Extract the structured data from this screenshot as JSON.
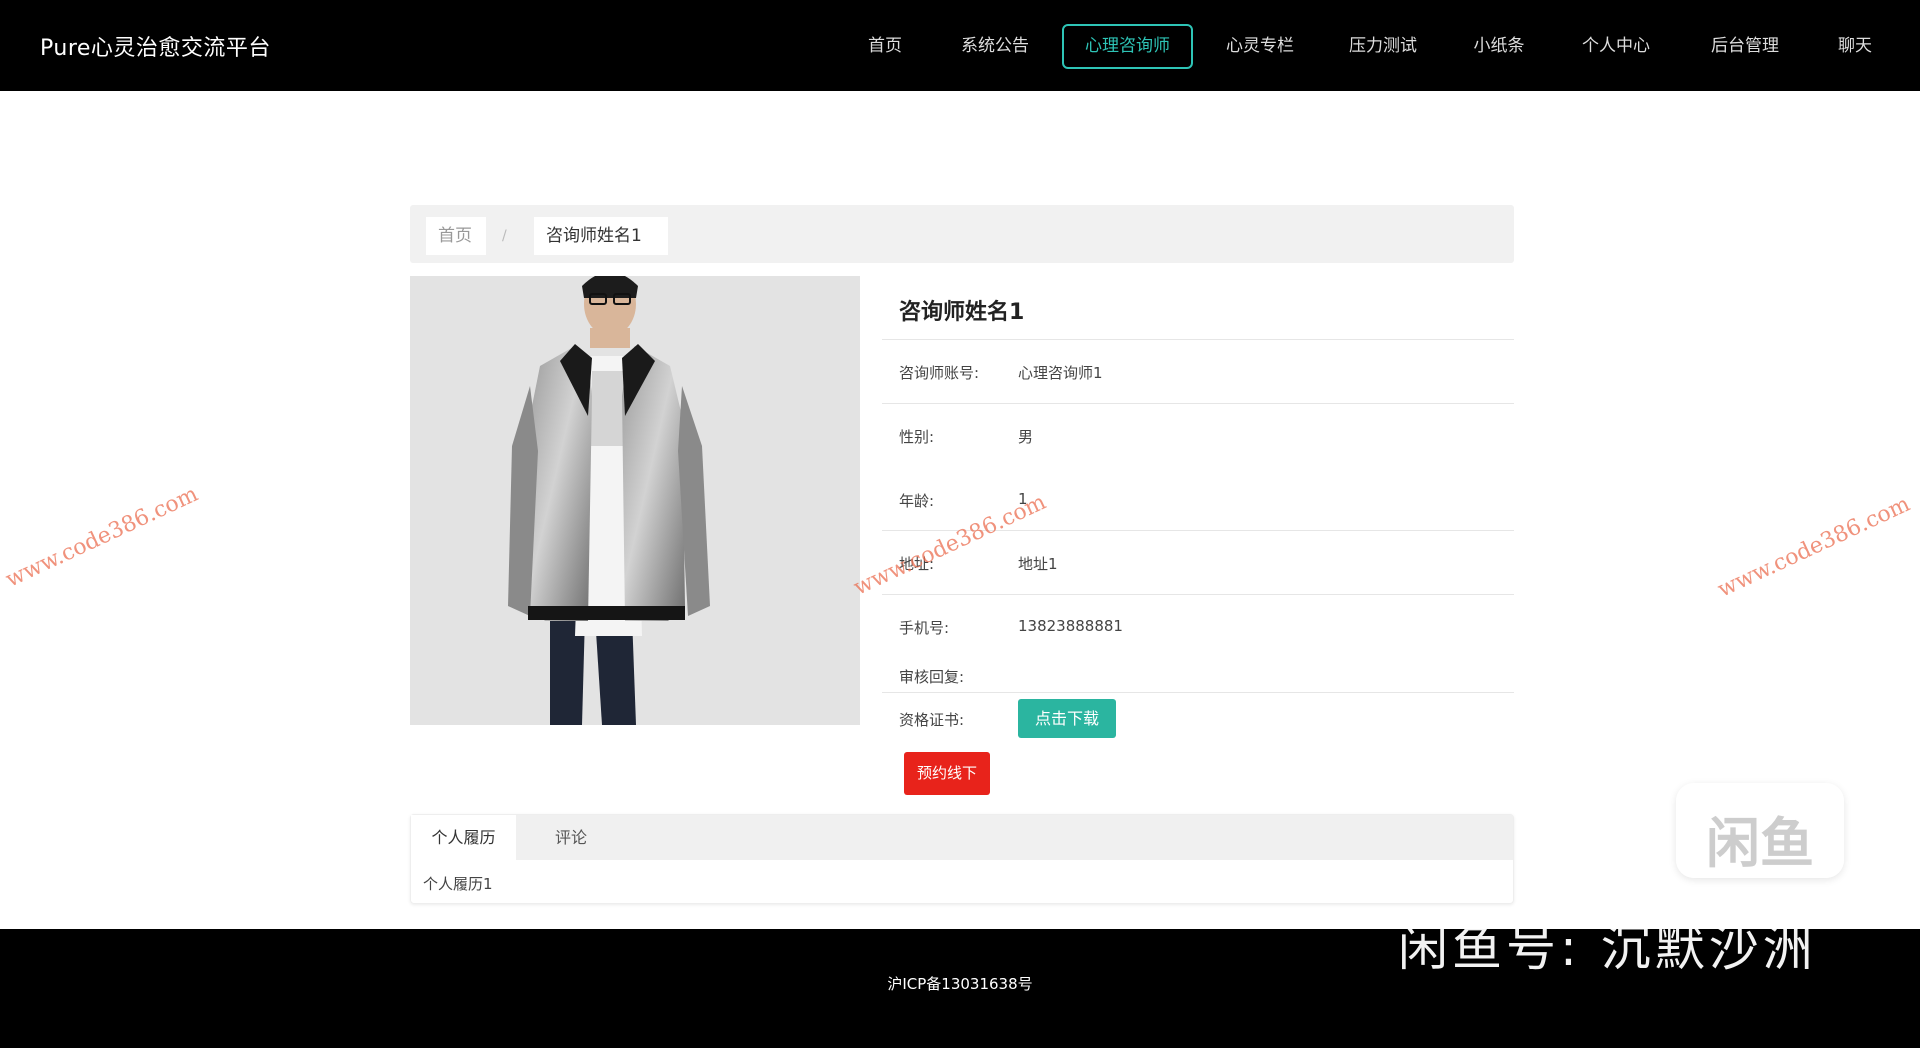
{
  "header": {
    "brand": "Pure心灵治愈交流平台",
    "nav": [
      {
        "label": "首页",
        "active": false
      },
      {
        "label": "系统公告",
        "active": false
      },
      {
        "label": "心理咨询师",
        "active": true
      },
      {
        "label": "心灵专栏",
        "active": false
      },
      {
        "label": "压力测试",
        "active": false
      },
      {
        "label": "小纸条",
        "active": false
      },
      {
        "label": "个人中心",
        "active": false
      },
      {
        "label": "后台管理",
        "active": false
      },
      {
        "label": "聊天",
        "active": false
      }
    ]
  },
  "breadcrumb": {
    "home": "首页",
    "separator": "/",
    "current": "咨询师姓名1"
  },
  "detail": {
    "name": "咨询师姓名1",
    "fields": [
      {
        "label": "咨询师账号:",
        "value": "心理咨询师1"
      },
      {
        "label": "性别:",
        "value": "男"
      },
      {
        "label": "年龄:",
        "value": "1"
      },
      {
        "label": "地址:",
        "value": "地址1"
      },
      {
        "label": "手机号:",
        "value": "13823888881"
      },
      {
        "label": "审核回复:",
        "value": ""
      },
      {
        "label": "资格证书:",
        "value": ""
      }
    ],
    "download_label": "点击下载",
    "book_label": "预约线下"
  },
  "tabs": {
    "items": [
      "个人履历",
      "评论"
    ],
    "active": 0,
    "content": "个人履历1"
  },
  "footer": {
    "icp": "沪ICP备13031638号"
  },
  "watermarks": {
    "site": "www.code386.com",
    "xianyu_logo": "闲鱼",
    "xianyu_id": "闲鱼号: 沉默沙洲"
  },
  "colors": {
    "header_bg": "#000000",
    "accent": "#2ec4b6",
    "download_btn": "#2bb5a0",
    "book_btn": "#e8231b"
  }
}
